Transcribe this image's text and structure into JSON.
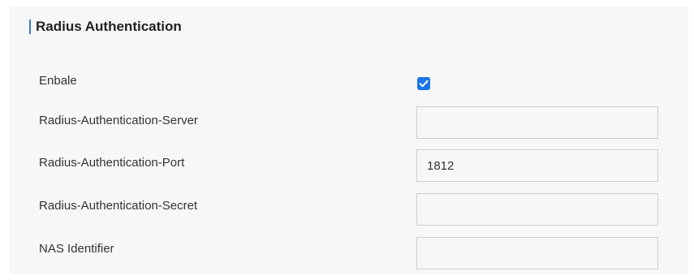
{
  "section": {
    "title": "Radius Authentication",
    "accent_color": "#3a7bd5"
  },
  "fields": {
    "enable": {
      "label": "Enbale",
      "checked": true
    },
    "server": {
      "label": "Radius-Authentication-Server",
      "value": ""
    },
    "port": {
      "label": "Radius-Authentication-Port",
      "value": "1812"
    },
    "secret": {
      "label": "Radius-Authentication-Secret",
      "value": ""
    },
    "nas_identifier": {
      "label": "NAS Identifier",
      "value": ""
    }
  },
  "colors": {
    "checkbox_checked": "#1a73e8",
    "panel_background": "#f7f7f7",
    "input_border": "#cfcfcf"
  }
}
